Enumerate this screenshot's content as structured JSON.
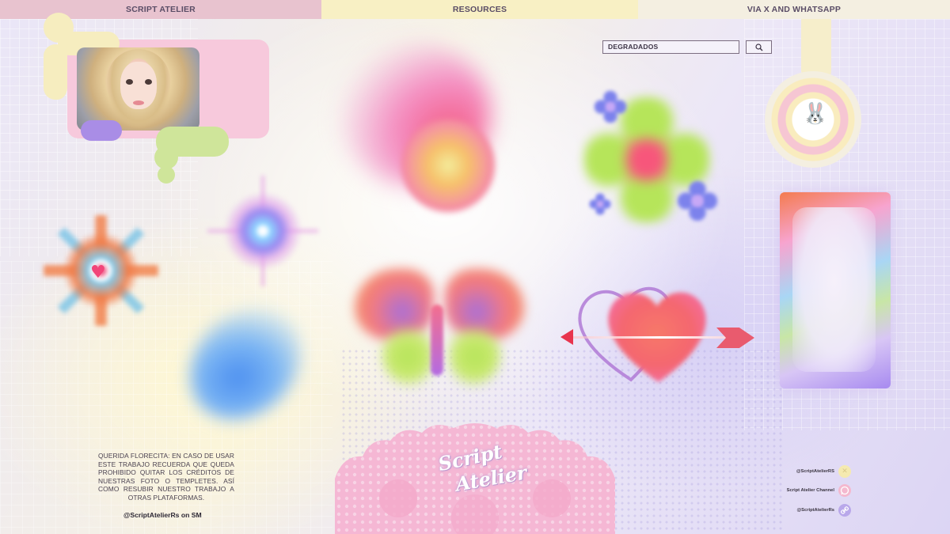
{
  "nav": {
    "tabs": [
      {
        "label": "SCRIPT ATELIER"
      },
      {
        "label": "RESOURCES"
      },
      {
        "label": "VIA X AND WHATSAPP"
      }
    ]
  },
  "search": {
    "value": "DEGRADADOS",
    "button_icon": "search-icon"
  },
  "pendant": {
    "icon": "bunny-icon",
    "glyph": "🐰"
  },
  "notice": {
    "text": "QUERIDA FLORECITA: EN CASO DE USAR ESTE TRABAJO RECUERDA QUE QUEDA PROHIBIDO QUITAR LOS CRÉDITOS DE NUESTRAS FOTO O TEMPLETES. ASÍ COMO RESUBIR NUESTRO TRABAJO A OTRAS PLATAFORMAS."
  },
  "handle": "@ScriptAtelierRs on SM",
  "socials": [
    {
      "label": "@ScriptAtelierRS",
      "icon": "x-icon",
      "color": "#f5eab0"
    },
    {
      "label": "Script Atelier Channel",
      "icon": "whatsapp-icon",
      "color": "#f4b9cf"
    },
    {
      "label": "@ScriptAtelierRs",
      "icon": "link-icon",
      "color": "#b9a8ea"
    }
  ],
  "logo": {
    "line1": "Script",
    "line2": "Atelier"
  },
  "colors": {
    "nav_pink": "#e8c3cf",
    "nav_yellow": "#f8f0c4",
    "nav_cream": "#f4efe1",
    "lace_pink": "#f5b7d4"
  }
}
